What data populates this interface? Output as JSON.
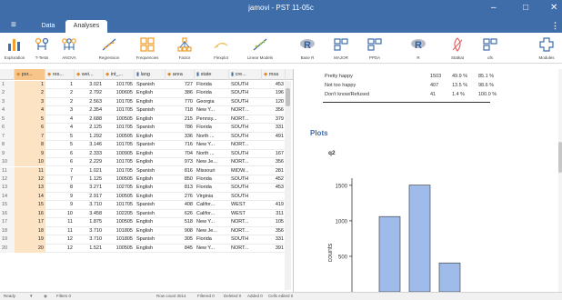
{
  "window": {
    "title": "jamovi - PST 11-05c",
    "minimize": "–",
    "maximize": "□",
    "close": "✕"
  },
  "tabs": {
    "menu": "≡",
    "data": "Data",
    "analyses": "Analyses",
    "more": "⋮"
  },
  "ribbon": [
    {
      "label": "Exploration",
      "icon": "exploration-icon"
    },
    {
      "label": "T-Tests",
      "icon": "t-tests-icon"
    },
    {
      "label": "ANOVA",
      "icon": "anova-icon"
    },
    {
      "label": "Regression",
      "icon": "regression-icon"
    },
    {
      "label": "Frequencies",
      "icon": "frequencies-icon"
    },
    {
      "label": "Factor",
      "icon": "factor-icon"
    },
    {
      "label": "Flexplot",
      "icon": "flexplot-icon"
    },
    {
      "label": "Linear Models",
      "icon": "linear-models-icon"
    },
    {
      "label": "Base R",
      "icon": "base-r-icon"
    },
    {
      "label": "MAJOR",
      "icon": "major-icon"
    },
    {
      "label": "PPDA",
      "icon": "ppda-icon"
    },
    {
      "label": "R",
      "icon": "r-icon"
    },
    {
      "label": "Statkat",
      "icon": "statkat-icon"
    },
    {
      "label": "ufs",
      "icon": "ufs-icon"
    },
    {
      "label": "Modules",
      "icon": "modules-icon"
    }
  ],
  "grid": {
    "columns": [
      "psr...",
      "res...",
      "wei...",
      "int_...",
      "lang",
      "area",
      "state",
      "cre...",
      "msa"
    ],
    "rows": [
      [
        "1",
        "1",
        "3.021",
        "101705",
        "Spanish",
        "727",
        "Florida",
        "SOUTH",
        "453"
      ],
      [
        "2",
        "2",
        "2.792",
        "100605",
        "English",
        "386",
        "Florida",
        "SOUTH",
        "196"
      ],
      [
        "3",
        "2",
        "2.563",
        "101705",
        "English",
        "770",
        "Georgia",
        "SOUTH",
        "120"
      ],
      [
        "4",
        "3",
        "2.354",
        "101705",
        "Spanish",
        "718",
        "New Y...",
        "NORT...",
        "356"
      ],
      [
        "5",
        "4",
        "2.688",
        "100505",
        "English",
        "215",
        "Pennsy...",
        "NORT...",
        "379"
      ],
      [
        "6",
        "4",
        "2.125",
        "101705",
        "Spanish",
        "786",
        "Florida",
        "SOUTH",
        "331"
      ],
      [
        "7",
        "5",
        "1.292",
        "100505",
        "English",
        "336",
        "North ...",
        "SOUTH",
        "491"
      ],
      [
        "8",
        "5",
        "3.146",
        "101705",
        "Spanish",
        "716",
        "New Y...",
        "NORT...",
        ""
      ],
      [
        "9",
        "6",
        "2.333",
        "100905",
        "English",
        "704",
        "North ...",
        "SOUTH",
        "167"
      ],
      [
        "10",
        "6",
        "2.229",
        "101705",
        "English",
        "973",
        "New Je...",
        "NORT...",
        "356"
      ],
      [
        "11",
        "7",
        "1.021",
        "101705",
        "Spanish",
        "816",
        "Missouri",
        "MIDW...",
        "281"
      ],
      [
        "12",
        "7",
        "1.125",
        "100505",
        "English",
        "850",
        "Florida",
        "SOUTH",
        "452"
      ],
      [
        "13",
        "8",
        "3.271",
        "102705",
        "English",
        "813",
        "Florida",
        "SOUTH",
        "453"
      ],
      [
        "14",
        "9",
        "2.917",
        "100505",
        "English",
        "276",
        "Virginia",
        "SOUTH",
        ""
      ],
      [
        "15",
        "9",
        "3.710",
        "101705",
        "Spanish",
        "408",
        "Califor...",
        "WEST",
        "419"
      ],
      [
        "16",
        "10",
        "3.458",
        "102205",
        "Spanish",
        "626",
        "Califor...",
        "WEST",
        "311"
      ],
      [
        "17",
        "11",
        "1.875",
        "100505",
        "English",
        "518",
        "New Y...",
        "NORT...",
        "105"
      ],
      [
        "18",
        "11",
        "3.710",
        "101805",
        "English",
        "908",
        "New Je...",
        "NORT...",
        "356"
      ],
      [
        "19",
        "12",
        "3.710",
        "101805",
        "Spanish",
        "305",
        "Florida",
        "SOUTH",
        "331"
      ],
      [
        "20",
        "12",
        "1.521",
        "100505",
        "English",
        "845",
        "New Y...",
        "NORT...",
        "391"
      ]
    ]
  },
  "results": {
    "freq_rows": [
      [
        "Pretty happy",
        "1503",
        "49.9 %",
        "85.1 %"
      ],
      [
        "Not too happy",
        "407",
        "13.5 %",
        "98.6 %"
      ],
      [
        "Don't know/Refused",
        "41",
        "1.4 %",
        "100.0 %"
      ]
    ],
    "plots_heading": "Plots",
    "plot_title": "q2"
  },
  "chart_data": {
    "type": "bar",
    "ylabel": "counts",
    "yticks": [
      "1500",
      "1000",
      "500"
    ],
    "values": [
      1060,
      1503,
      407
    ],
    "ylim": [
      0,
      1600
    ]
  },
  "status": {
    "ready": "Ready",
    "filters": "Filters 0",
    "row_count": "Row count 3014",
    "filtered": "Filtered 0",
    "deleted": "Deleted 0",
    "added": "Added 0",
    "cells_edited": "Cells edited 0"
  },
  "colors": {
    "titlebar": "#3e6da9",
    "bar_fill": "#9ebbea",
    "selected_column": "#f7c48a"
  }
}
